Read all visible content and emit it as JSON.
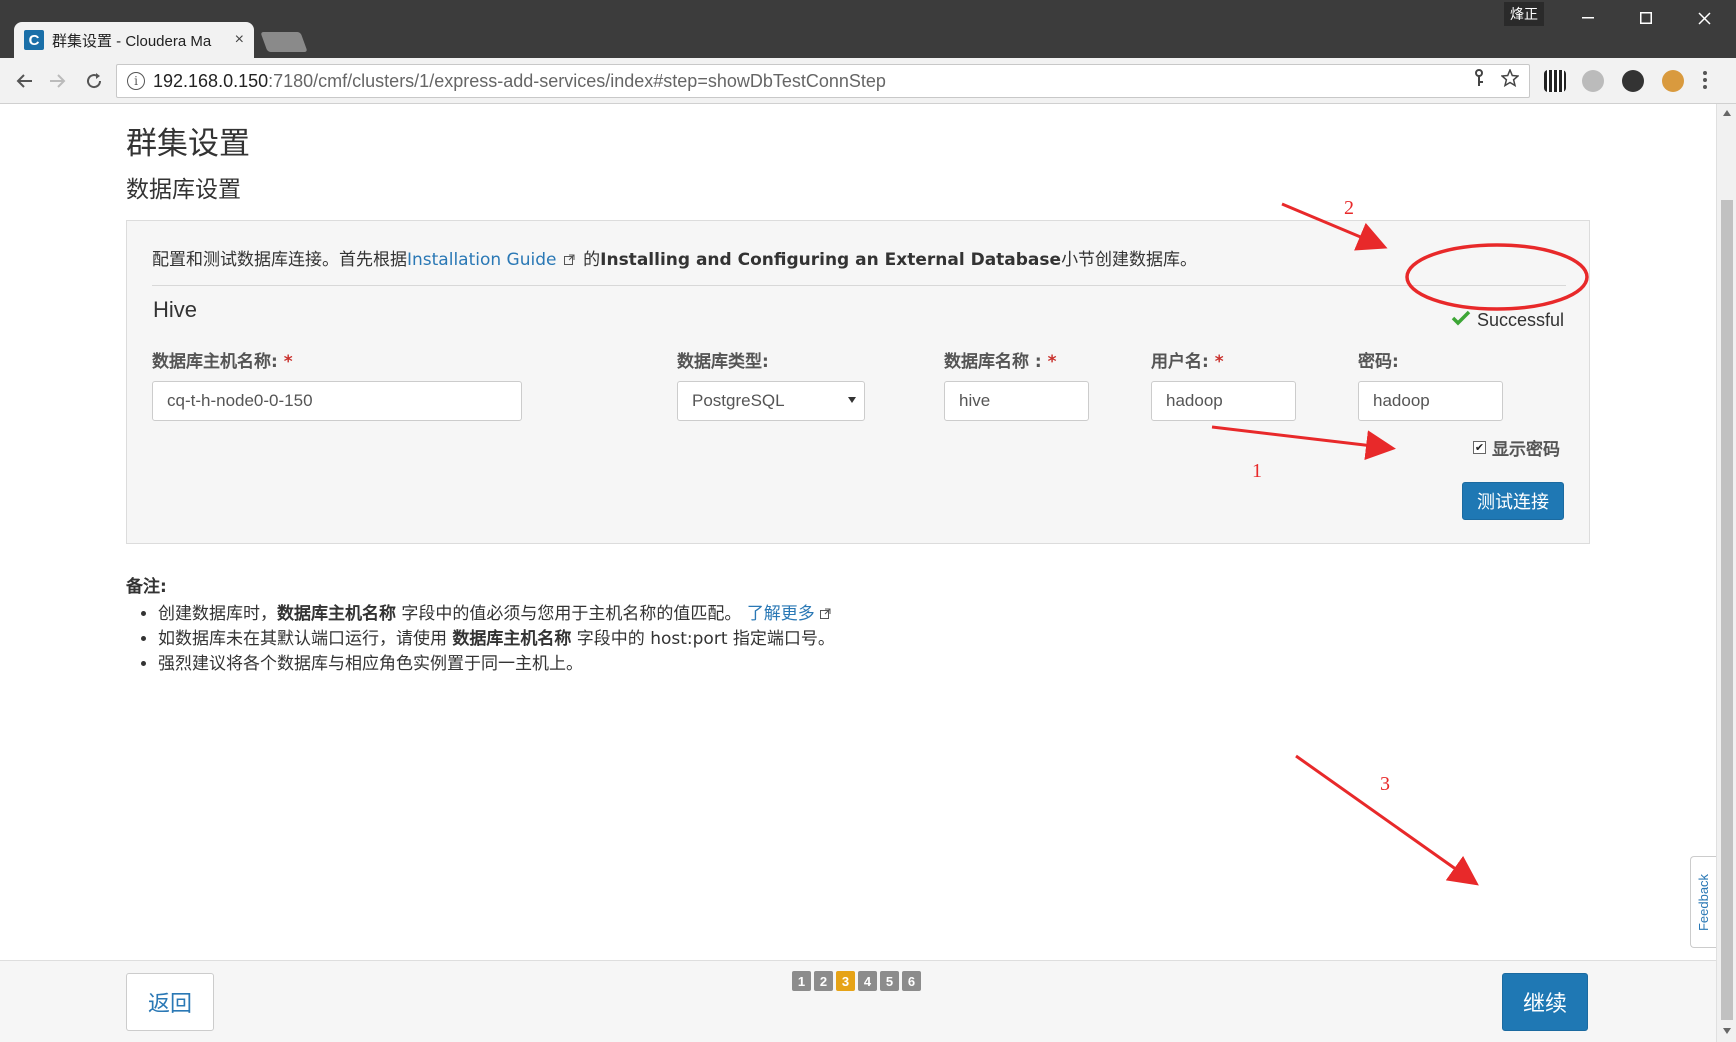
{
  "browser": {
    "tab_title": "群集设置 - Cloudera Ma",
    "tab_favicon": "C",
    "close_glyph": "×",
    "user_chip": "烽正",
    "url_host": "192.168.0.150",
    "url_rest": ":7180/cmf/clusters/1/express-add-services/index#step=showDbTestConnStep",
    "info_glyph": "i"
  },
  "page": {
    "title": "群集设置",
    "subtitle": "数据库设置"
  },
  "intro": {
    "prefix": "配置和测试数据库连接。首先根据",
    "link": "Installation Guide",
    "middle": "的",
    "bold": "Installing and Configuring an External Database",
    "suffix": "小节创建数据库。"
  },
  "service": {
    "name": "Hive",
    "status": "Successful",
    "status_color": "#3da636"
  },
  "fields": {
    "host_label": "数据库主机名称:",
    "host_value": "cq-t-h-node0-0-150",
    "type_label": "数据库类型:",
    "type_value": "PostgreSQL",
    "name_label": "数据库名称 :",
    "name_value": "hive",
    "user_label": "用户名:",
    "user_value": "hadoop",
    "password_label": "密码:",
    "password_value": "hadoop",
    "required_mark": "*"
  },
  "show_password": {
    "label": "显示密码",
    "checked_glyph": "✔"
  },
  "test_button": "测试连接",
  "notes": {
    "title": "备注:",
    "item1_pre": "创建数据库时，",
    "item1_bold": "数据库主机名称",
    "item1_post": " 字段中的值必须与您用于主机名称的值匹配。",
    "item1_link": "了解更多",
    "item2_pre": "如数据库未在其默认端口运行，请使用 ",
    "item2_bold": "数据库主机名称",
    "item2_post": " 字段中的 host:port 指定端口号。",
    "item3": "强烈建议将各个数据库与相应角色实例置于同一主机上。"
  },
  "footer": {
    "back": "返回",
    "continue": "继续",
    "steps": [
      "1",
      "2",
      "3",
      "4",
      "5",
      "6"
    ],
    "active_step": 3
  },
  "feedback": "Feedback",
  "annotations": {
    "label1": "1",
    "label2": "2",
    "label3": "3",
    "color": "#e8292a"
  },
  "colors": {
    "primary": "#1f78b4",
    "link": "#2a78b5",
    "active_step": "#e6a317"
  }
}
